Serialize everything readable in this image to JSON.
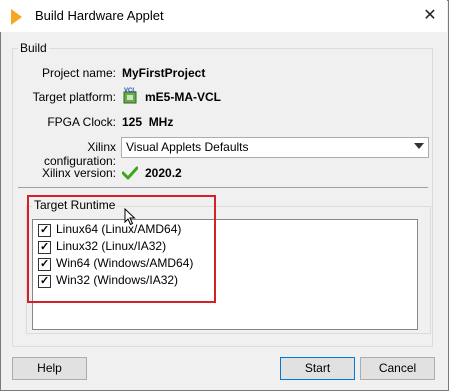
{
  "window": {
    "title": "Build Hardware Applet",
    "close_glyph": "✕"
  },
  "build": {
    "legend": "Build",
    "project_name": {
      "label": "Project name:",
      "value": "MyFirstProject"
    },
    "target_platform": {
      "label": "Target platform:",
      "value": "mE5-MA-VCL",
      "icon": "vcl-chip-icon",
      "icon_text": "VCL"
    },
    "fpga_clock": {
      "label": "FPGA Clock:",
      "value": "125  MHz"
    },
    "xilinx_configuration": {
      "label": "Xilinx configuration:",
      "selected": "Visual Applets Defaults"
    },
    "xilinx_version": {
      "label": "Xilinx version:",
      "value": "2020.2",
      "status_icon": "green-check-icon",
      "status_color": "#3aa81a"
    }
  },
  "target_runtime": {
    "legend": "Target Runtime",
    "items": [
      {
        "label": "Linux64 (Linux/AMD64)",
        "checked": true
      },
      {
        "label": "Linux32 (Linux/IA32)",
        "checked": true
      },
      {
        "label": "Win64 (Windows/AMD64)",
        "checked": true
      },
      {
        "label": "Win32 (Windows/IA32)",
        "checked": true
      }
    ],
    "highlight_color": "#d3202a"
  },
  "buttons": {
    "help": "Help",
    "start": "Start",
    "cancel": "Cancel"
  },
  "check_glyph": "✓"
}
